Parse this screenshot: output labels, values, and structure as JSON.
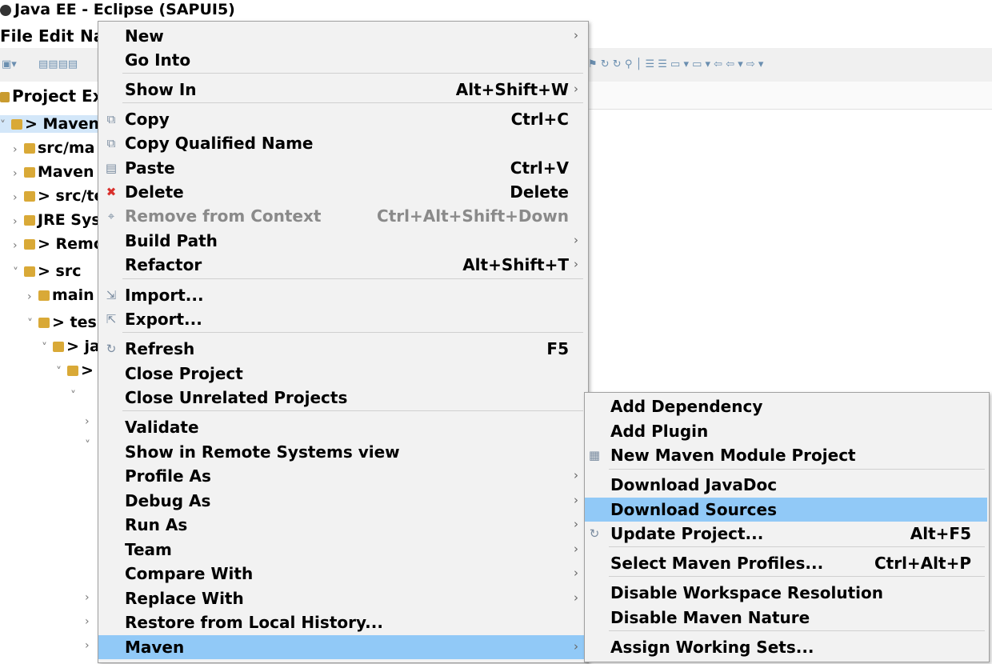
{
  "window": {
    "title": "Java EE - Eclipse (SAPUI5)",
    "app_icon": "eclipse-icon"
  },
  "menubar": {
    "file": "File",
    "edit": "Edit",
    "navigate": "Na"
  },
  "explorer": {
    "title": "Project Exp",
    "rows": [
      {
        "twisty": "v",
        "label": "> Maven"
      },
      {
        "twisty": ">",
        "label": "src/ma"
      },
      {
        "twisty": ">",
        "label": "Maven"
      },
      {
        "twisty": ">",
        "label": "> src/te"
      },
      {
        "twisty": ">",
        "label": "JRE Sys"
      },
      {
        "twisty": ">",
        "label": "> Remo"
      },
      {
        "twisty": "v",
        "label": "> src"
      },
      {
        "twisty": ">",
        "label": "main"
      },
      {
        "twisty": "v",
        "label": "> tes"
      },
      {
        "twisty": "v",
        "label": "> ja"
      },
      {
        "twisty": "v",
        "label": ">"
      },
      {
        "twisty": "v",
        "label": ""
      },
      {
        "twisty": ">",
        "label": ""
      },
      {
        "twisty": "v",
        "label": ""
      },
      {
        "twisty": ">",
        "label": ""
      },
      {
        "twisty": ">",
        "label": ""
      },
      {
        "twisty": ">",
        "label": ""
      }
    ]
  },
  "context_menu": {
    "items": [
      {
        "label": "New",
        "shortcut": "",
        "submenu": true
      },
      {
        "label": "Go Into",
        "shortcut": ""
      },
      {
        "label": "Show In",
        "shortcut": "Alt+Shift+W",
        "submenu": true
      },
      {
        "label": "Copy",
        "shortcut": "Ctrl+C",
        "icon": "copy-icon"
      },
      {
        "label": "Copy Qualified Name",
        "shortcut": "",
        "icon": "copy-qualified-icon"
      },
      {
        "label": "Paste",
        "shortcut": "Ctrl+V",
        "icon": "paste-icon"
      },
      {
        "label": "Delete",
        "shortcut": "Delete",
        "icon": "delete-icon"
      },
      {
        "label": "Remove from Context",
        "shortcut": "Ctrl+Alt+Shift+Down",
        "disabled": true,
        "icon": "remove-context-icon"
      },
      {
        "label": "Build Path",
        "shortcut": "",
        "submenu": true
      },
      {
        "label": "Refactor",
        "shortcut": "Alt+Shift+T",
        "submenu": true
      },
      {
        "label": "Import...",
        "shortcut": "",
        "icon": "import-icon"
      },
      {
        "label": "Export...",
        "shortcut": "",
        "icon": "export-icon"
      },
      {
        "label": "Refresh",
        "shortcut": "F5",
        "icon": "refresh-icon"
      },
      {
        "label": "Close Project",
        "shortcut": ""
      },
      {
        "label": "Close Unrelated Projects",
        "shortcut": ""
      },
      {
        "label": "Validate",
        "shortcut": ""
      },
      {
        "label": "Show in Remote Systems view",
        "shortcut": ""
      },
      {
        "label": "Profile As",
        "shortcut": "",
        "submenu": true
      },
      {
        "label": "Debug As",
        "shortcut": "",
        "submenu": true
      },
      {
        "label": "Run As",
        "shortcut": "",
        "submenu": true
      },
      {
        "label": "Team",
        "shortcut": "",
        "submenu": true
      },
      {
        "label": "Compare With",
        "shortcut": "",
        "submenu": true
      },
      {
        "label": "Replace With",
        "shortcut": "",
        "submenu": true
      },
      {
        "label": "Restore from Local History...",
        "shortcut": ""
      },
      {
        "label": "Maven",
        "shortcut": "",
        "submenu": true,
        "highlighted": true
      }
    ]
  },
  "maven_submenu": {
    "items": [
      {
        "label": "Add Dependency",
        "shortcut": ""
      },
      {
        "label": "Add Plugin",
        "shortcut": ""
      },
      {
        "label": "New Maven Module Project",
        "shortcut": "",
        "icon": "maven-module-icon"
      },
      {
        "label": "Download JavaDoc",
        "shortcut": ""
      },
      {
        "label": "Download Sources",
        "shortcut": "",
        "highlighted": true
      },
      {
        "label": "Update Project...",
        "shortcut": "Alt+F5",
        "icon": "update-project-icon"
      },
      {
        "label": "Select Maven Profiles...",
        "shortcut": "Ctrl+Alt+P"
      },
      {
        "label": "Disable Workspace Resolution",
        "shortcut": ""
      },
      {
        "label": "Disable Maven Nature",
        "shortcut": ""
      },
      {
        "label": "Assign Working Sets...",
        "shortcut": ""
      }
    ]
  },
  "colors": {
    "highlight": "#91c9f7",
    "menu_bg": "#f2f2f2",
    "selection": "#d3e7f9"
  }
}
